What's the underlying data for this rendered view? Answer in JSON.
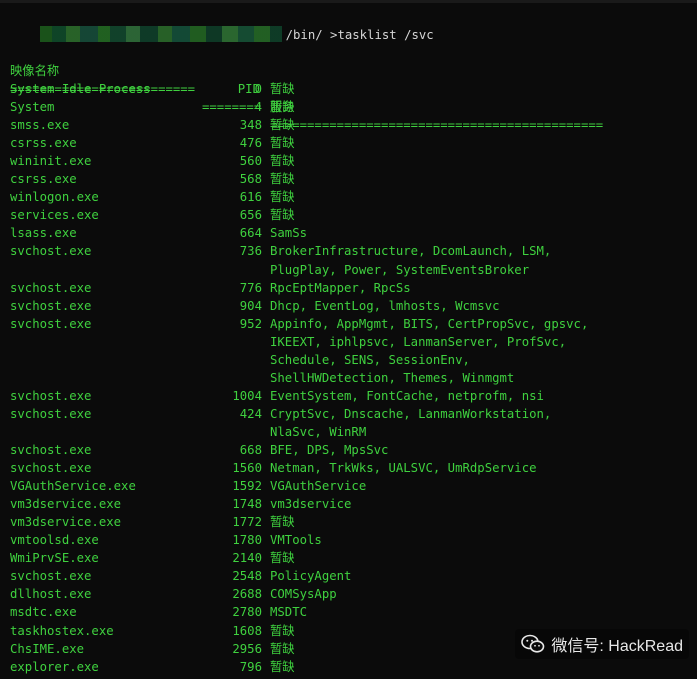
{
  "prompt": {
    "path": "/bin/ >tasklist /svc"
  },
  "header": {
    "image_name": "映像名称",
    "pid": "PID",
    "services": "服务",
    "sep_name": "=========================",
    "sep_pid": "========",
    "sep_svc": "============================================="
  },
  "rows": [
    {
      "name": "System Idle Process",
      "pid": "0",
      "svc": "暂缺"
    },
    {
      "name": "System",
      "pid": "4",
      "svc": "暂缺"
    },
    {
      "name": "smss.exe",
      "pid": "348",
      "svc": "暂缺"
    },
    {
      "name": "csrss.exe",
      "pid": "476",
      "svc": "暂缺"
    },
    {
      "name": "wininit.exe",
      "pid": "560",
      "svc": "暂缺"
    },
    {
      "name": "csrss.exe",
      "pid": "568",
      "svc": "暂缺"
    },
    {
      "name": "winlogon.exe",
      "pid": "616",
      "svc": "暂缺"
    },
    {
      "name": "services.exe",
      "pid": "656",
      "svc": "暂缺"
    },
    {
      "name": "lsass.exe",
      "pid": "664",
      "svc": "SamSs"
    },
    {
      "name": "svchost.exe",
      "pid": "736",
      "svc": "BrokerInfrastructure, DcomLaunch, LSM,"
    },
    {
      "name": "",
      "pid": "",
      "svc": "PlugPlay, Power, SystemEventsBroker"
    },
    {
      "name": "svchost.exe",
      "pid": "776",
      "svc": "RpcEptMapper, RpcSs"
    },
    {
      "name": "svchost.exe",
      "pid": "904",
      "svc": "Dhcp, EventLog, lmhosts, Wcmsvc"
    },
    {
      "name": "svchost.exe",
      "pid": "952",
      "svc": "Appinfo, AppMgmt, BITS, CertPropSvc, gpsvc,"
    },
    {
      "name": "",
      "pid": "",
      "svc": "IKEEXT, iphlpsvc, LanmanServer, ProfSvc,"
    },
    {
      "name": "",
      "pid": "",
      "svc": "Schedule, SENS, SessionEnv,"
    },
    {
      "name": "",
      "pid": "",
      "svc": "ShellHWDetection, Themes, Winmgmt"
    },
    {
      "name": "svchost.exe",
      "pid": "1004",
      "svc": "EventSystem, FontCache, netprofm, nsi"
    },
    {
      "name": "svchost.exe",
      "pid": "424",
      "svc": "CryptSvc, Dnscache, LanmanWorkstation,"
    },
    {
      "name": "",
      "pid": "",
      "svc": "NlaSvc, WinRM"
    },
    {
      "name": "svchost.exe",
      "pid": "668",
      "svc": "BFE, DPS, MpsSvc"
    },
    {
      "name": "svchost.exe",
      "pid": "1560",
      "svc": "Netman, TrkWks, UALSVC, UmRdpService"
    },
    {
      "name": "VGAuthService.exe",
      "pid": "1592",
      "svc": "VGAuthService"
    },
    {
      "name": "vm3dservice.exe",
      "pid": "1748",
      "svc": "vm3dservice"
    },
    {
      "name": "vm3dservice.exe",
      "pid": "1772",
      "svc": "暂缺"
    },
    {
      "name": "vmtoolsd.exe",
      "pid": "1780",
      "svc": "VMTools"
    },
    {
      "name": "WmiPrvSE.exe",
      "pid": "2140",
      "svc": "暂缺"
    },
    {
      "name": "svchost.exe",
      "pid": "2548",
      "svc": "PolicyAgent"
    },
    {
      "name": "dllhost.exe",
      "pid": "2688",
      "svc": "COMSysApp"
    },
    {
      "name": "msdtc.exe",
      "pid": "2780",
      "svc": "MSDTC"
    },
    {
      "name": "taskhostex.exe",
      "pid": "1608",
      "svc": "暂缺"
    },
    {
      "name": "ChsIME.exe",
      "pid": "2956",
      "svc": "暂缺"
    },
    {
      "name": "explorer.exe",
      "pid": "796",
      "svc": "暂缺"
    }
  ],
  "watermark": {
    "text": "微信号: HackRead"
  },
  "colors": {
    "terminal_bg": "#0b0b0b",
    "text_green": "#3fd13f",
    "prompt_text": "#d6d6d6"
  }
}
